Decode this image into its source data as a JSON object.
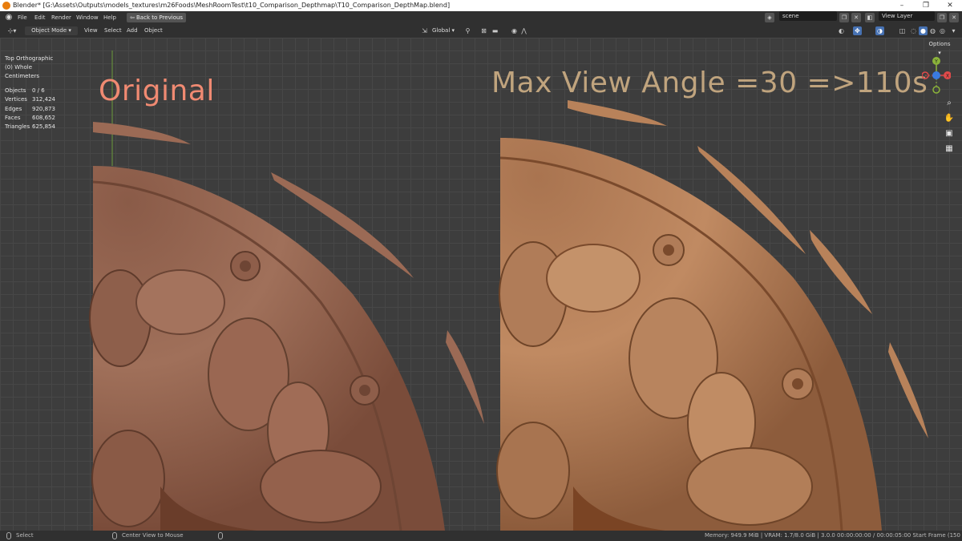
{
  "window": {
    "title": "Blender* [G:\\Assets\\Outputs\\models_textures\\m26Foods\\MeshRoomTest\\t10_Comparison_Depthmap\\T10_Comparison_DepthMap.blend]",
    "minimize": "–",
    "maximize": "❐",
    "close": "✕"
  },
  "menubar": {
    "items": [
      "File",
      "Edit",
      "Render",
      "Window",
      "Help"
    ],
    "back_button": "Back to Previous",
    "scene_value": "scene",
    "view_layer_value": "View Layer"
  },
  "header": {
    "mode": "Object Mode",
    "menus": [
      "View",
      "Select",
      "Add",
      "Object"
    ],
    "transform_orientation": "Global",
    "options_label": "Options"
  },
  "viewport": {
    "view_name": "Top Orthographic",
    "collection": "(0) Whole",
    "units": "Centimeters",
    "stats": [
      {
        "label": "Objects",
        "value": "0 / 6"
      },
      {
        "label": "Vertices",
        "value": "312,424"
      },
      {
        "label": "Edges",
        "value": "920,873"
      },
      {
        "label": "Faces",
        "value": "608,652"
      },
      {
        "label": "Triangles",
        "value": "625,854"
      }
    ],
    "overlay_left": "Original",
    "overlay_right": "Max View Angle =30 =>110s",
    "gizmo_axes": {
      "x": "X",
      "y": "Y",
      "z": "Z"
    },
    "colors": {
      "overlay_left": "#f08a72",
      "overlay_right": "#c0a47e",
      "mesh_left": "#9b6a55",
      "mesh_right": "#b8825a"
    }
  },
  "statusbar": {
    "select": "Select",
    "center_view": "Center View to Mouse",
    "info": "Memory: 949.9 MiB | VRAM: 1.7/8.0 GiB | 3.0.0   00:00:00:00 / 00:00:05:00  Start Frame (150 left)"
  },
  "icons": [
    "blender-icon",
    "back-icon",
    "scene-icon",
    "view-layer-icon",
    "zoom-icon",
    "hand-icon",
    "camera-icon",
    "grid-icon"
  ]
}
